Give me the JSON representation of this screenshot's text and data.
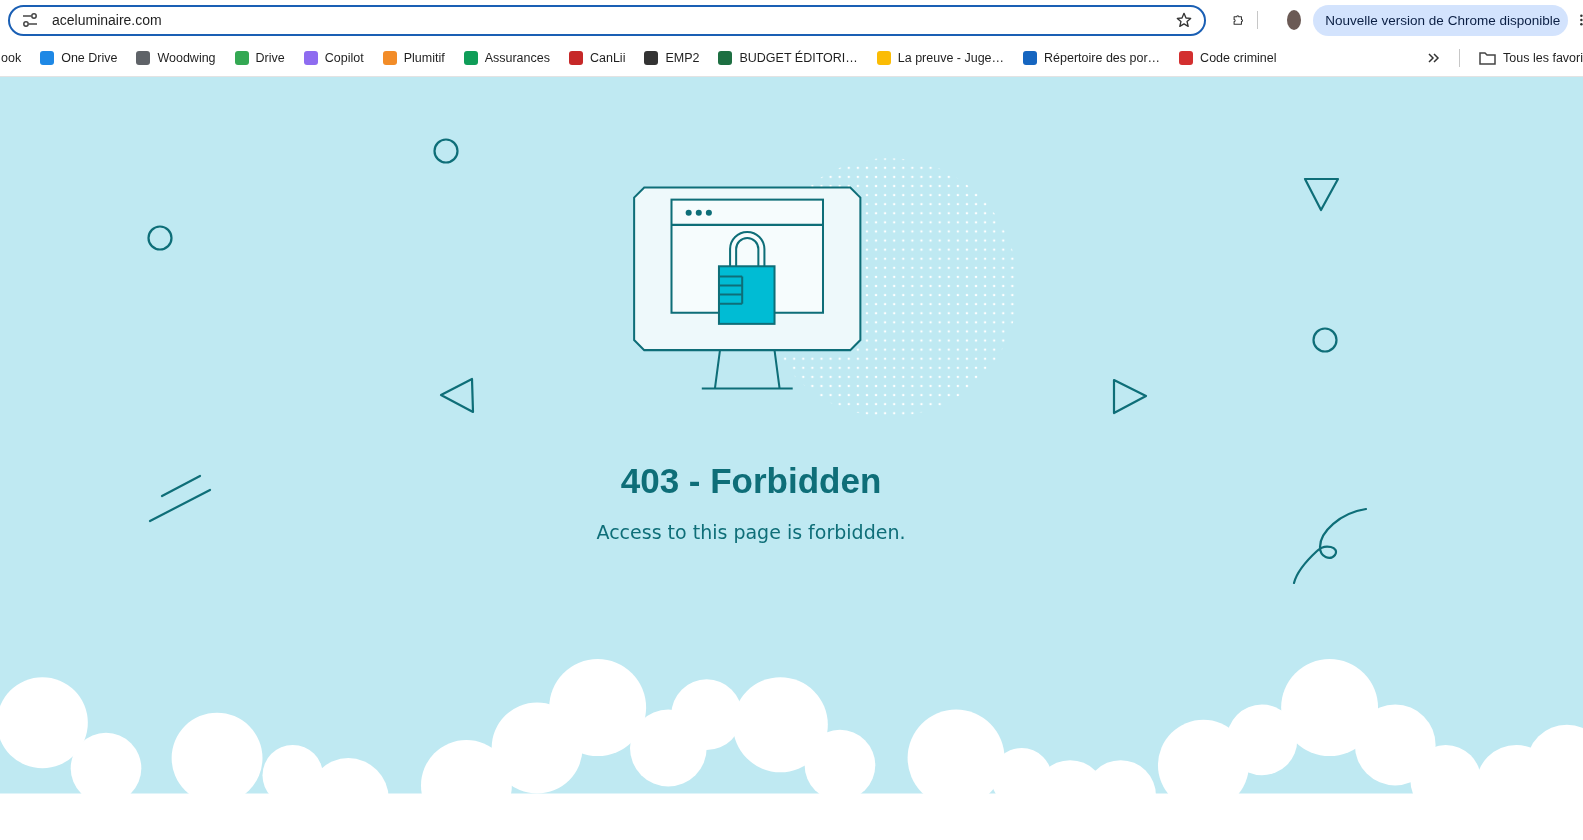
{
  "address_bar": {
    "url": "aceluminaire.com"
  },
  "update_button": {
    "label": "Nouvelle version de Chrome disponible"
  },
  "bookmarks": [
    {
      "label": "ook"
    },
    {
      "label": "One Drive",
      "color": "#1e88e5"
    },
    {
      "label": "Woodwing",
      "color": "#5f6368"
    },
    {
      "label": "Drive",
      "color": "#34a853"
    },
    {
      "label": "Copilot",
      "color": "#8e6cf0"
    },
    {
      "label": "Plumitif",
      "color": "#f28c28"
    },
    {
      "label": "Assurances",
      "color": "#0f9d58"
    },
    {
      "label": "CanLii",
      "color": "#c62828"
    },
    {
      "label": "EMP2",
      "color": "#333333"
    },
    {
      "label": "BUDGET ÉDITORI…",
      "color": "#1d6f42"
    },
    {
      "label": "La preuve - Juge…",
      "color": "#fbbc04"
    },
    {
      "label": "Répertoire des por…",
      "color": "#1565c0"
    },
    {
      "label": "Code criminel",
      "color": "#d32f2f"
    }
  ],
  "all_bookmarks": {
    "label": "Tous les favori"
  },
  "page": {
    "title": "403 - Forbidden",
    "message": "Access to this page is forbidden."
  }
}
